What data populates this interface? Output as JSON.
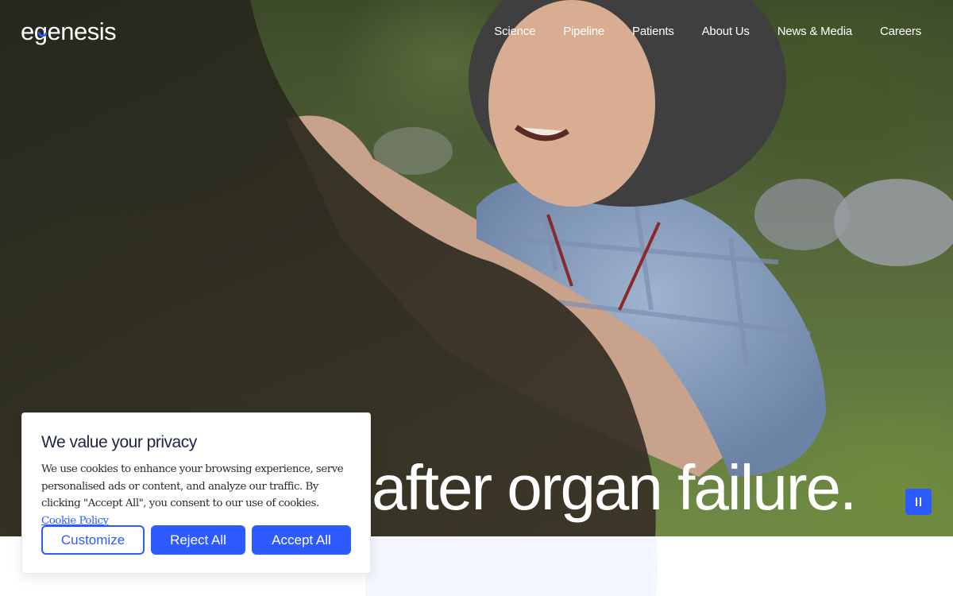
{
  "brand": {
    "logo_text": "egenesis"
  },
  "nav": {
    "items": [
      {
        "label": "Science"
      },
      {
        "label": "Pipeline"
      },
      {
        "label": "Patients"
      },
      {
        "label": "About Us"
      },
      {
        "label": "News & Media"
      },
      {
        "label": "Careers"
      }
    ]
  },
  "hero": {
    "headline": "after organ failure.",
    "pause_icon": "pause-icon"
  },
  "cookie_banner": {
    "title": "We value your privacy",
    "body": "We use cookies to enhance your browsing experience, serve personalised ads or content, and analyze our traffic. By clicking \"Accept All\", you consent to our use of cookies.",
    "policy_link": "Cookie Policy",
    "buttons": {
      "customize": "Customize",
      "reject": "Reject All",
      "accept": "Accept All"
    }
  },
  "colors": {
    "accent": "#2d5bff",
    "heading": "#1d2546",
    "text_on_hero": "#ffffff"
  }
}
